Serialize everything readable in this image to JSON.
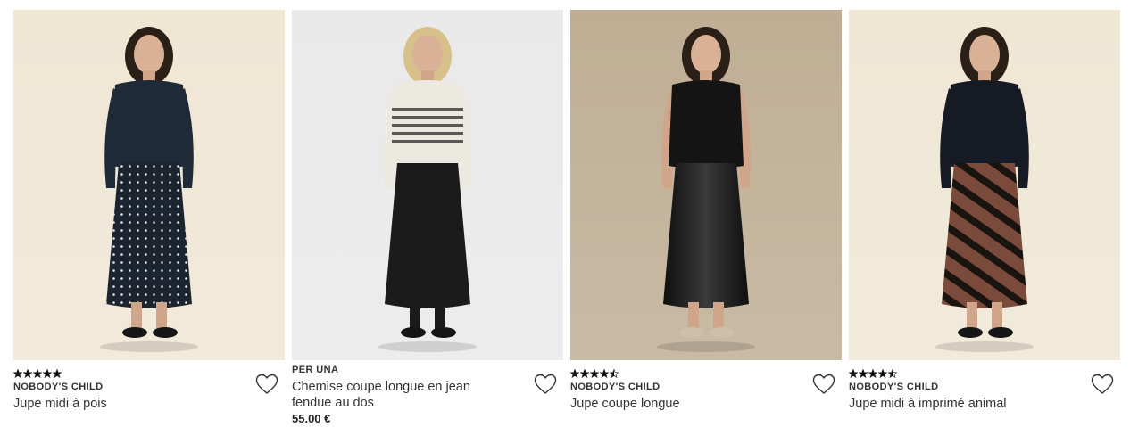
{
  "products": [
    {
      "brand": "NOBODY'S CHILD",
      "name": "Jupe midi à pois",
      "price": "",
      "rating": 5,
      "bg": "#efe6d4",
      "top": "#1f2a38",
      "skirt": "#1c2430",
      "skirtPattern": "dots"
    },
    {
      "brand": "PER UNA",
      "name": "Chemise coupe longue en jean fendue au dos",
      "price": "55.00 €",
      "rating": null,
      "bg": "#e9e9e9",
      "top": "#ece9e0",
      "skirt": "#1b1b1b",
      "skirtPattern": "plain"
    },
    {
      "brand": "NOBODY'S CHILD",
      "name": "Jupe coupe longue",
      "price": "",
      "rating": 4.5,
      "bg": "#bfae94",
      "top": "#141414",
      "skirt": "#0f0f0f",
      "skirtPattern": "satin"
    },
    {
      "brand": "NOBODY'S CHILD",
      "name": "Jupe midi à imprimé animal",
      "price": "",
      "rating": 4.5,
      "bg": "#efe6d4",
      "top": "#151a24",
      "skirt": "#7a4a3a",
      "skirtPattern": "zebra"
    }
  ]
}
